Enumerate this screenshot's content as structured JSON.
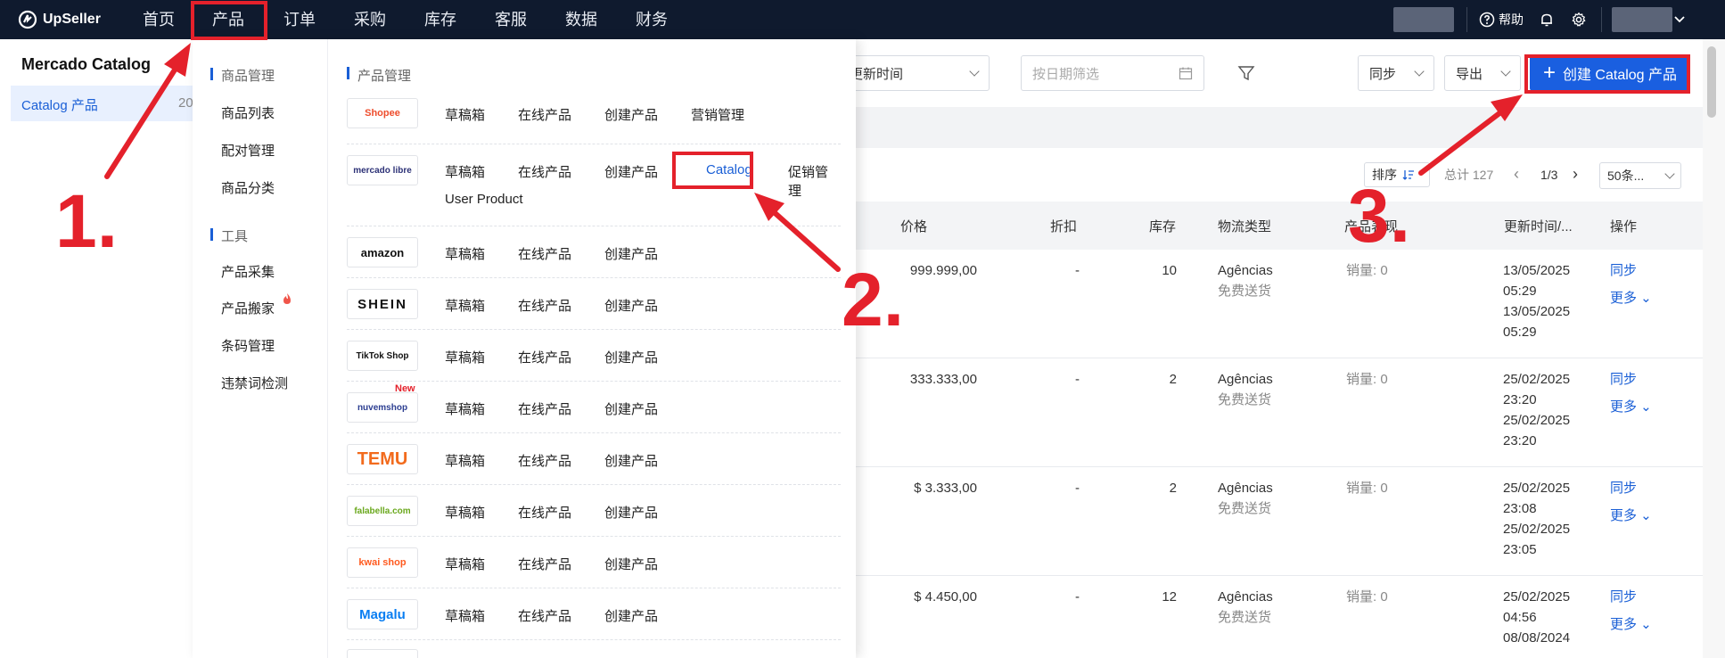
{
  "topnav": {
    "brand": "UpSeller",
    "items": [
      "首页",
      "产品",
      "订单",
      "采购",
      "库存",
      "客服",
      "数据",
      "财务"
    ],
    "help": "帮助"
  },
  "sidebar": {
    "title": "Mercado Catalog",
    "item_label": "Catalog 产品",
    "item_count": "20"
  },
  "toolbar": {
    "sort_field": "更新时间",
    "date_placeholder": "按日期筛选",
    "sync": "同步",
    "export": "导出",
    "create": "创建 Catalog 产品"
  },
  "table": {
    "sort_label": "排序",
    "total": "总计 127",
    "page": "1/3",
    "page_size": "50条...",
    "headers": [
      "价格",
      "折扣",
      "库存",
      "物流类型",
      "产品表现",
      "更新时间/...",
      "操作"
    ],
    "rows": [
      {
        "price": "999.999,00",
        "discount": "-",
        "stock": "10",
        "logistics": "Agências",
        "shipping": "免费送货",
        "sales": "销量: 0",
        "t1": "13/05/2025",
        "t2": "05:29",
        "t3": "13/05/2025",
        "t4": "05:29",
        "sync": "同步",
        "more": "更多"
      },
      {
        "price": "333.333,00",
        "discount": "-",
        "stock": "2",
        "logistics": "Agências",
        "shipping": "免费送货",
        "sales": "销量: 0",
        "t1": "25/02/2025",
        "t2": "23:20",
        "t3": "25/02/2025",
        "t4": "23:20",
        "sync": "同步",
        "more": "更多"
      },
      {
        "price": "$ 3.333,00",
        "discount": "-",
        "stock": "2",
        "logistics": "Agências",
        "shipping": "免费送货",
        "sales": "销量: 0",
        "t1": "25/02/2025",
        "t2": "23:08",
        "t3": "25/02/2025",
        "t4": "23:05",
        "sync": "同步",
        "more": "更多"
      },
      {
        "price": "$ 4.450,00",
        "discount": "-",
        "stock": "12",
        "logistics": "Agências",
        "shipping": "免费送货",
        "sales": "销量: 0",
        "t1": "25/02/2025",
        "t2": "04:56",
        "t3": "08/08/2024",
        "t4": "",
        "sync": "同步",
        "more": "更多"
      }
    ]
  },
  "menu": {
    "group1_title": "商品管理",
    "group1_items": [
      "商品列表",
      "配对管理",
      "商品分类"
    ],
    "group2_title": "工具",
    "group2_items": [
      "产品采集",
      "产品搬家",
      "条码管理",
      "违禁词检测"
    ],
    "section_title": "产品管理",
    "platforms": [
      {
        "name": "Shopee",
        "links": [
          "草稿箱",
          "在线产品",
          "创建产品",
          "营销管理"
        ]
      },
      {
        "name": "mercado libre",
        "links": [
          "草稿箱",
          "在线产品",
          "创建产品",
          "Catalog",
          "促销管理"
        ],
        "extra": "User Product"
      },
      {
        "name": "amazon",
        "links": [
          "草稿箱",
          "在线产品",
          "创建产品"
        ]
      },
      {
        "name": "SHEIN",
        "links": [
          "草稿箱",
          "在线产品",
          "创建产品"
        ]
      },
      {
        "name": "TikTok Shop",
        "links": [
          "草稿箱",
          "在线产品",
          "创建产品"
        ]
      },
      {
        "name": "nuvemshop",
        "links": [
          "草稿箱",
          "在线产品",
          "创建产品"
        ],
        "badge": "New"
      },
      {
        "name": "TEMU",
        "links": [
          "草稿箱",
          "在线产品",
          "创建产品"
        ]
      },
      {
        "name": "falabella.com",
        "links": [
          "草稿箱",
          "在线产品",
          "创建产品"
        ]
      },
      {
        "name": "kwai shop",
        "links": [
          "草稿箱",
          "在线产品",
          "创建产品"
        ]
      },
      {
        "name": "Magalu",
        "links": [
          "草稿箱",
          "在线产品",
          "创建产品"
        ]
      }
    ]
  },
  "annotations": {
    "step1": "1.",
    "step2": "2.",
    "step3": "3."
  },
  "colors": {
    "nav_bg": "#0f1a2e",
    "primary": "#1a5fe0",
    "annotation_red": "#e4212b"
  }
}
